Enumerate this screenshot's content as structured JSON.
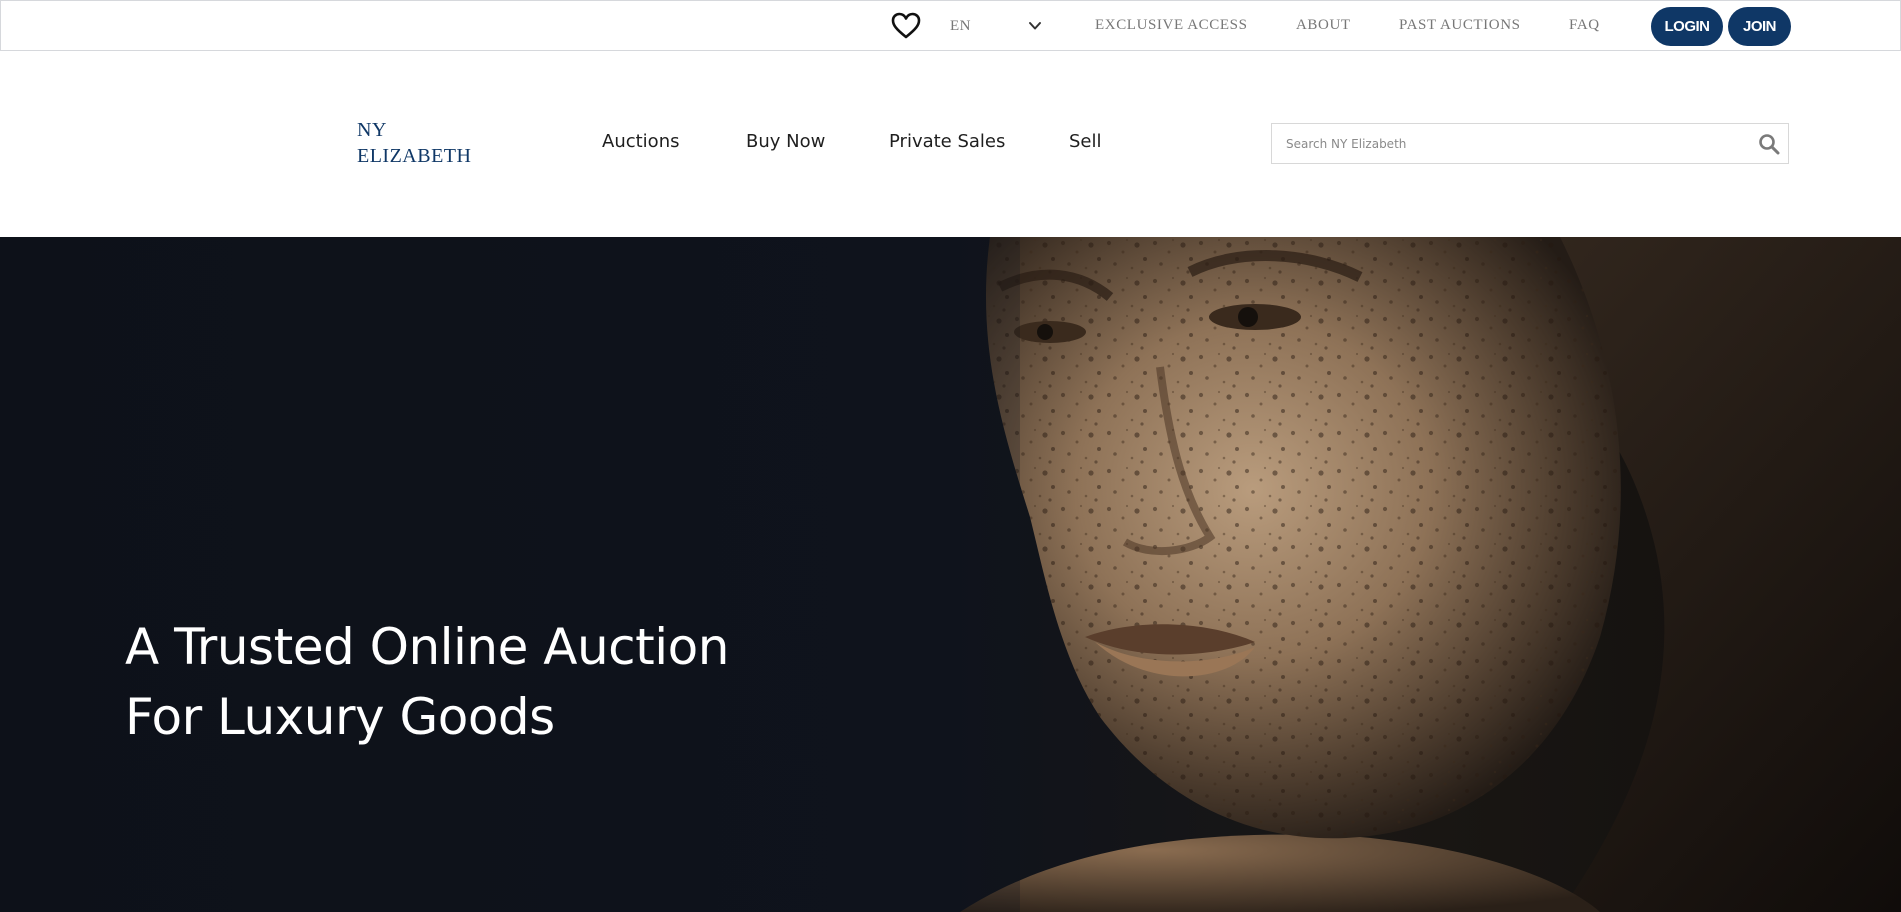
{
  "utility_bar": {
    "language": "EN",
    "links": [
      "EXCLUSIVE ACCESS",
      "ABOUT",
      "PAST AUCTIONS",
      "FAQ"
    ],
    "login_label": "LOGIN",
    "join_label": "JOIN",
    "icons": {
      "favorites": "heart-icon",
      "language_dropdown": "chevron-down-icon"
    }
  },
  "header": {
    "logo": {
      "line1": "NY",
      "line2": "ELIZABETH"
    },
    "nav": [
      "Auctions",
      "Buy Now",
      "Private Sales",
      "Sell"
    ],
    "search": {
      "placeholder": "Search NY Elizabeth",
      "value": "",
      "icon": "search-icon"
    }
  },
  "hero": {
    "title_line1": "A Trusted Online Auction",
    "title_line2": "For Luxury Goods"
  },
  "colors": {
    "brand_navy": "#0f3766",
    "hero_background": "#0e131d",
    "utility_text": "#777777",
    "nav_text": "#1f1f1f"
  }
}
